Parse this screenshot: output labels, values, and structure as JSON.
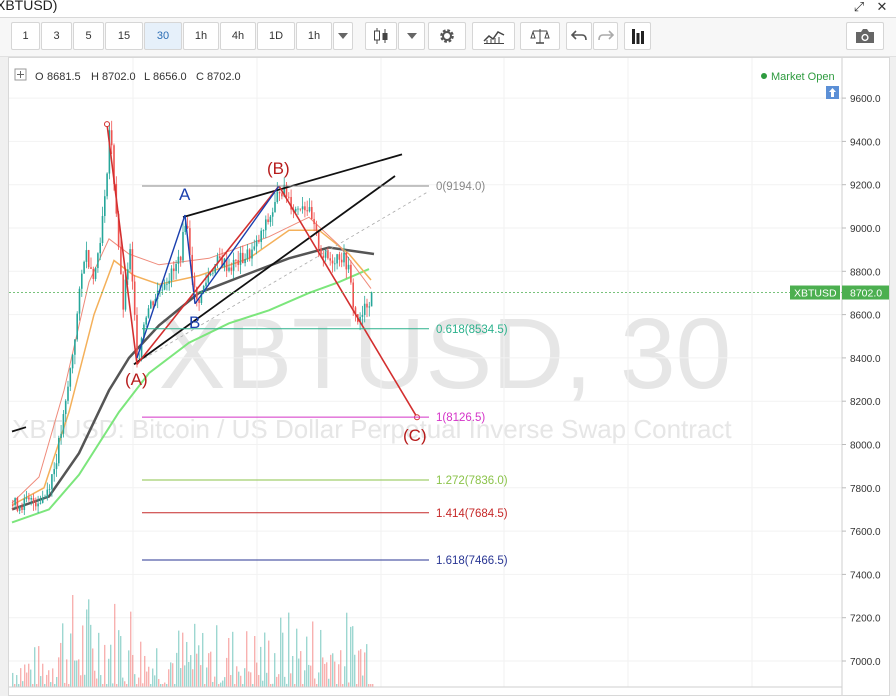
{
  "window": {
    "title": "XBTUSD)"
  },
  "toolbar": {
    "intervals": [
      "1",
      "3",
      "5",
      "15",
      "30",
      "1h",
      "4h",
      "1D",
      "1h"
    ],
    "active_interval": "30"
  },
  "ohlc": {
    "o_label": "O",
    "o": "8681.5",
    "h_label": "H",
    "h": "8702.0",
    "l_label": "L",
    "l": "8656.0",
    "c_label": "C",
    "c": "8702.0"
  },
  "market_status": "Market Open",
  "watermark": {
    "symbol": "XBTUSD, 30",
    "description": "XBTUSD: Bitcoin / US Dollar Perpetual Inverse Swap Contract"
  },
  "price_tag": {
    "symbol": "XBTUSD",
    "price": "8702.0"
  },
  "colors": {
    "up": "#26a69a",
    "down": "#ef5350",
    "accent": "#2a6db5",
    "market_open": "#2e9b3f",
    "price_tag": "#4caf50"
  },
  "icons": [
    "fullscreen-icon",
    "close-icon",
    "candlestick-icon",
    "chevron-down-icon",
    "gear-icon",
    "indicators-icon",
    "compare-icon",
    "undo-icon",
    "redo-icon",
    "bar-chart-icon",
    "camera-icon",
    "crosshair-icon",
    "arrow-up-icon"
  ],
  "chart_data": {
    "type": "line",
    "symbol": "XBTUSD",
    "interval": "30",
    "y_axis": {
      "ticks": [
        7000,
        7200,
        7400,
        7600,
        7800,
        8000,
        8200,
        8400,
        8600,
        8800,
        9000,
        9200,
        9400,
        9600
      ],
      "tick_labels": [
        "7000.0",
        "7200.0",
        "7400.0",
        "7600.0",
        "7800.0",
        "8000.0",
        "8200.0",
        "8400.0",
        "8600.0",
        "8800.0",
        "9000.0",
        "9200.0",
        "9400.0",
        "9600.0"
      ],
      "range": [
        6890,
        9680
      ]
    },
    "fib_levels": [
      {
        "ratio": "0",
        "price": 9194.0,
        "label": "0(9194.0)",
        "color": "#888888"
      },
      {
        "ratio": "0.618",
        "price": 8534.5,
        "label": "0.618(8534.5)",
        "color": "#2bb18c"
      },
      {
        "ratio": "1",
        "price": 8126.5,
        "label": "1(8126.5)",
        "color": "#d433c8"
      },
      {
        "ratio": "1.272",
        "price": 7836.0,
        "label": "1.272(7836.0)",
        "color": "#8bc34a"
      },
      {
        "ratio": "1.414",
        "price": 7684.5,
        "label": "1.414(7684.5)",
        "color": "#c62828"
      },
      {
        "ratio": "1.618",
        "price": 7466.5,
        "label": "1.618(7466.5)",
        "color": "#283593"
      }
    ],
    "wave_labels": [
      {
        "text": "(A)",
        "color": "#b71c1c"
      },
      {
        "text": "(B)",
        "color": "#b71c1c"
      },
      {
        "text": "(C)",
        "color": "#b71c1c"
      },
      {
        "text": "A",
        "color": "#1a3fae"
      },
      {
        "text": "B",
        "color": "#1a3fae"
      }
    ],
    "last_price": 8702.0
  }
}
